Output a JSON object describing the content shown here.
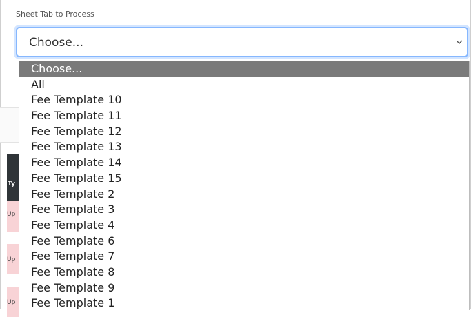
{
  "form": {
    "label": "Sheet Tab to Process",
    "selected_value": "Choose...",
    "chevron_glyph": "⌄"
  },
  "dropdown": {
    "options": [
      "Choose...",
      "All",
      "Fee Template 10",
      "Fee Template 11",
      "Fee Template 12",
      "Fee Template 13",
      "Fee Template 14",
      "Fee Template 15",
      "Fee Template 2",
      "Fee Template 3",
      "Fee Template 4",
      "Fee Template 6",
      "Fee Template 7",
      "Fee Template 8",
      "Fee Template 9",
      "Fee Template 1"
    ],
    "highlighted_index": 0
  },
  "background": {
    "header_fragment": "Ty",
    "row_fragments": [
      "Up",
      "Up",
      "Up"
    ]
  },
  "colors": {
    "focus_border": "#86b7fe",
    "highlight": "#7a7a7a",
    "table_header": "#2f3438",
    "row_tint": "#f8d3d6"
  }
}
